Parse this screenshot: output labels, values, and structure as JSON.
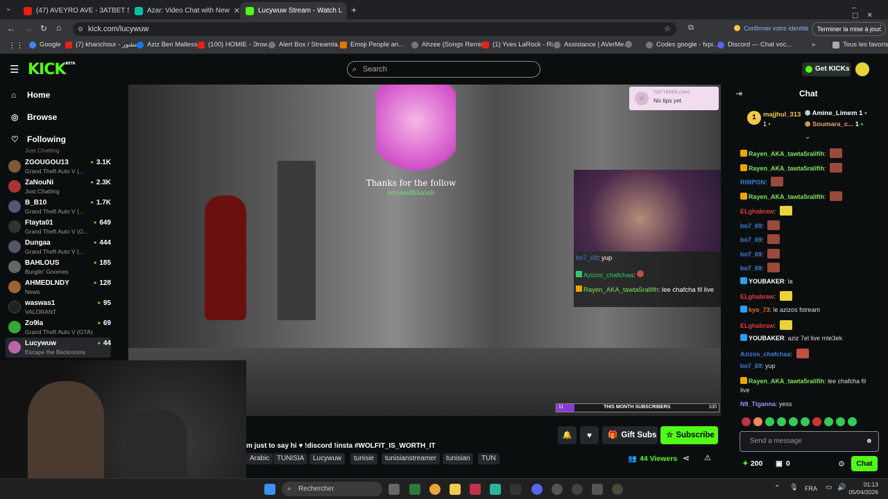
{
  "tabs": [
    {
      "label": "(47) AVEYRO AVE - 3ATBET SEN",
      "color": "#e62117"
    },
    {
      "label": "Azar: Video Chat with New",
      "color": "#00c2a8"
    },
    {
      "label": "Lucywuw Stream - Watch L",
      "color": "#53fc18"
    }
  ],
  "address": {
    "url": "kick.com/lucywuw",
    "confirm": "Confirmer votre identité",
    "update": "Terminer la mise à jour"
  },
  "bookmarks": [
    {
      "label": "Google",
      "color": "#4285f4"
    },
    {
      "label": "(7) khanchour - خنشور",
      "color": "#e62117"
    },
    {
      "label": "Aziz Ben Mallessa",
      "color": "#1877f2"
    },
    {
      "label": "(100) HOMIE - Эгои...",
      "color": "#e62117"
    },
    {
      "label": "Alert Box / Streamla...",
      "color": "#777"
    },
    {
      "label": "Emoji People an...",
      "color": "#e8710a"
    },
    {
      "label": "Ahzee (Songs Remix...",
      "color": "#777"
    },
    {
      "label": "(1) Yves LaRock - Ri...",
      "color": "#e62117"
    },
    {
      "label": "Assistance | AVerMe...",
      "color": "#777"
    },
    {
      "label": "",
      "color": "#777"
    },
    {
      "label": "Codes google - fxpi...",
      "color": "#777"
    },
    {
      "label": "Discord — Chat voc...",
      "color": "#5865f2"
    }
  ],
  "bookmarks_all": "Tous les favoris",
  "brand": {
    "logo": "KICK",
    "beta": "BETA"
  },
  "search": {
    "placeholder": "Search"
  },
  "get_kicks": "Get KICKs",
  "nav": {
    "home": "Home",
    "browse": "Browse",
    "following": "Following"
  },
  "channels_partial": "Just Chatting",
  "channels": [
    {
      "name": "ZGOUGOU13",
      "game": "Grand Theft Auto V (...",
      "viewers": "3.1K",
      "color": "#7a5a3a"
    },
    {
      "name": "ZaNouNi",
      "game": "Just Chatting",
      "viewers": "2.3K",
      "color": "#a33"
    },
    {
      "name": "B_B10",
      "game": "Grand Theft Auto V (...",
      "viewers": "1.7K",
      "color": "#557"
    },
    {
      "name": "Ftayta01",
      "game": "Grand Theft Auto V (G...",
      "viewers": "649",
      "color": "#333"
    },
    {
      "name": "Dungaa",
      "game": "Grand Theft Auto V (...",
      "viewers": "444",
      "color": "#556"
    },
    {
      "name": "BAHLOUS",
      "game": "Burglin' Gnomes",
      "viewers": "185",
      "color": "#666"
    },
    {
      "name": "AHMEDLNDY",
      "game": "News",
      "viewers": "128",
      "color": "#963"
    },
    {
      "name": "waswas1",
      "game": "VALORANT",
      "viewers": "95",
      "color": "#222"
    },
    {
      "name": "Zo9la",
      "game": "Grand Theft Auto V (GTA)",
      "viewers": "69",
      "color": "#3a3"
    },
    {
      "name": "Lucywuw",
      "game": "Escape the Backrooms",
      "viewers": "44",
      "color": "#b6a"
    }
  ],
  "overlay": {
    "follow_title": "Thanks for the follow",
    "follower": "youssefhbaieb",
    "top_tipper": "TOP TIPPER (24H)",
    "no_tips": "No tips yet",
    "sub_goal_current": "11",
    "sub_goal_label": "THIS MONTH SUBSCRIBERS",
    "sub_goal_target": "100",
    "sub_goal_progress": 0.11
  },
  "overlay_chat": [
    {
      "user": "bo7_69",
      "text": "yup",
      "color": "#3d7fd9"
    },
    {
      "user": "Azizos_chafchaa",
      "text": "",
      "color": "#2ecc71"
    },
    {
      "user": "Rayen_AKA_tawta5ralifih",
      "text": "lee chafcha fil live",
      "color": "#7ee35a"
    }
  ],
  "stream": {
    "title": "m just to say hi ♥ !discord !insta #WOLFIT_IS_WORTH_IT",
    "gift": "Gift Subs",
    "subscribe": "Subscribe",
    "viewers": "44",
    "viewers_label": "Viewers",
    "tags": [
      "Arabic",
      "TUNISIA",
      "Lucywuw",
      "tunisie",
      "tunisianstreamer",
      "tunisian",
      "TUN"
    ]
  },
  "chat": {
    "title": "Chat",
    "top_gifters": [
      {
        "rank": "1",
        "name": "majjhul_313",
        "count": "1"
      },
      {
        "name": "Amine_Limem",
        "count": "1"
      },
      {
        "name": "Soumara_c...",
        "count": "1"
      }
    ],
    "messages": [
      {
        "user": "Rayen_AKA_tawta5ralifih",
        "text": "",
        "color": "#7ee35a",
        "badge": "#f2a500",
        "emote": "#9a4a3a"
      },
      {
        "user": "Rayen_AKA_tawta5ralifih",
        "text": "",
        "color": "#7ee35a",
        "badge": "#f2a500",
        "emote": "#9a4a3a"
      },
      {
        "user": "RI9IPON",
        "text": "",
        "color": "#3d7fd9",
        "badge": "",
        "emote": "#9a4a3a"
      },
      {
        "user": "Rayen_AKA_tawta5ralifih",
        "text": "",
        "color": "#7ee35a",
        "badge": "#f2a500",
        "emote": "#9a4a3a"
      },
      {
        "user": "ELghabraw",
        "text": "",
        "color": "#e03a3a",
        "badge": "",
        "emote": "#e8d33a"
      },
      {
        "user": "bo7_69",
        "text": "",
        "color": "#3d7fd9",
        "badge": "",
        "emote": "#9a4a3a"
      },
      {
        "user": "bo7_69",
        "text": "",
        "color": "#3d7fd9",
        "badge": "",
        "emote": "#9a4a3a"
      },
      {
        "user": "bo7_69",
        "text": "",
        "color": "#3d7fd9",
        "badge": "",
        "emote": "#9a4a3a"
      },
      {
        "user": "bo7_69",
        "text": "",
        "color": "#3d7fd9",
        "badge": "",
        "emote": "#9a4a3a"
      },
      {
        "user": "YOUBAKER",
        "text": "la",
        "color": "#ffffff",
        "badge": "#2a9df4",
        "emote": ""
      },
      {
        "user": "ELghabraw",
        "text": "",
        "color": "#e03a3a",
        "badge": "",
        "emote": "#e8d33a"
      },
      {
        "user": "kyo_73",
        "text": "le azizos fstream",
        "color": "#e8710a",
        "badge": "#2a9df4",
        "emote": ""
      },
      {
        "user": "ELghabraw",
        "text": "",
        "color": "#e03a3a",
        "badge": "",
        "emote": "#e8d33a"
      },
      {
        "user": "YOUBAKER",
        "text": "aziz 7el live mte3ek",
        "color": "#ffffff",
        "badge": "#2a9df4",
        "emote": ""
      },
      {
        "user": "Azizos_chafchaa",
        "text": "",
        "color": "#3d7fd9",
        "badge": "",
        "emote": "#c05040"
      },
      {
        "user": "bo7_69",
        "text": "yup",
        "color": "#3d7fd9",
        "badge": "",
        "emote": ""
      },
      {
        "user": "Rayen_AKA_tawta5ralifih",
        "text": "lee chafcha fil",
        "color": "#7ee35a",
        "badge": "#f2a500",
        "emote": ""
      },
      {
        "user": "",
        "text": "live",
        "color": "#ddd",
        "badge": "",
        "emote": ""
      },
      {
        "user": "N9_Tiganna",
        "text": "yess",
        "color": "#a48bff",
        "badge": "",
        "emote": ""
      }
    ],
    "input_placeholder": "Send a message",
    "points": "200",
    "zero": "0",
    "send": "Chat"
  },
  "taskbar": {
    "search": "Rechercher",
    "lang": "FRA",
    "time": "01:13",
    "date": "05/04/2026"
  }
}
